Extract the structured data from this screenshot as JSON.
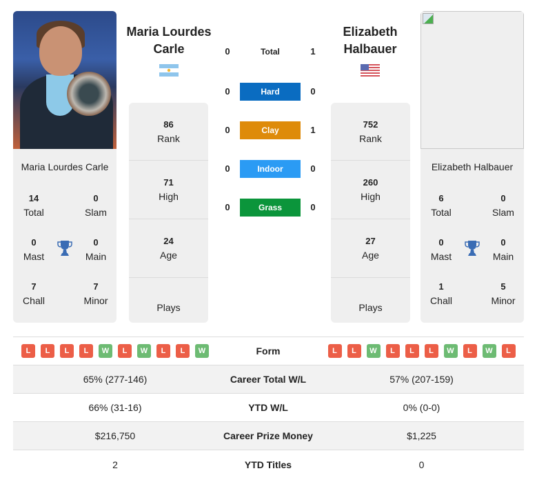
{
  "player1": {
    "name": "Maria Lourdes Carle",
    "flag": "argentina-flag",
    "photo": "player-photo",
    "rank": "86",
    "rank_label": "Rank",
    "high": "71",
    "high_label": "High",
    "age": "24",
    "age_label": "Age",
    "plays_label": "Plays",
    "titles": {
      "total": "14",
      "total_label": "Total",
      "slam": "0",
      "slam_label": "Slam",
      "mast": "0",
      "mast_label": "Mast",
      "main": "0",
      "main_label": "Main",
      "chall": "7",
      "chall_label": "Chall",
      "minor": "7",
      "minor_label": "Minor"
    },
    "form": [
      "L",
      "L",
      "L",
      "L",
      "W",
      "L",
      "W",
      "L",
      "L",
      "W"
    ],
    "career_wl": "65% (277-146)",
    "ytd_wl": "66% (31-16)",
    "prize_money": "$216,750",
    "ytd_titles": "2"
  },
  "player2": {
    "name": "Elizabeth Halbauer",
    "flag": "usa-flag",
    "photo": "broken-image",
    "rank": "752",
    "rank_label": "Rank",
    "high": "260",
    "high_label": "High",
    "age": "27",
    "age_label": "Age",
    "plays_label": "Plays",
    "titles": {
      "total": "6",
      "total_label": "Total",
      "slam": "0",
      "slam_label": "Slam",
      "mast": "0",
      "mast_label": "Mast",
      "main": "0",
      "main_label": "Main",
      "chall": "1",
      "chall_label": "Chall",
      "minor": "5",
      "minor_label": "Minor"
    },
    "form": [
      "L",
      "L",
      "W",
      "L",
      "L",
      "L",
      "W",
      "L",
      "W",
      "L"
    ],
    "career_wl": "57% (207-159)",
    "ytd_wl": "0% (0-0)",
    "prize_money": "$1,225",
    "ytd_titles": "0"
  },
  "h2h": [
    {
      "label": "Total",
      "p1": "0",
      "p2": "1",
      "color": ""
    },
    {
      "label": "Hard",
      "p1": "0",
      "p2": "0",
      "color": "#0a6cc1"
    },
    {
      "label": "Clay",
      "p1": "0",
      "p2": "1",
      "color": "#de8b0a"
    },
    {
      "label": "Indoor",
      "p1": "0",
      "p2": "0",
      "color": "#2b9bf4"
    },
    {
      "label": "Grass",
      "p1": "0",
      "p2": "0",
      "color": "#0b953b"
    }
  ],
  "table_labels": {
    "form": "Form",
    "career_wl": "Career Total W/L",
    "ytd_wl": "YTD W/L",
    "prize_money": "Career Prize Money",
    "ytd_titles": "YTD Titles"
  },
  "colors": {
    "win": "#6dbb73",
    "loss": "#ec5e47",
    "trophy": "#3a6cb4"
  }
}
